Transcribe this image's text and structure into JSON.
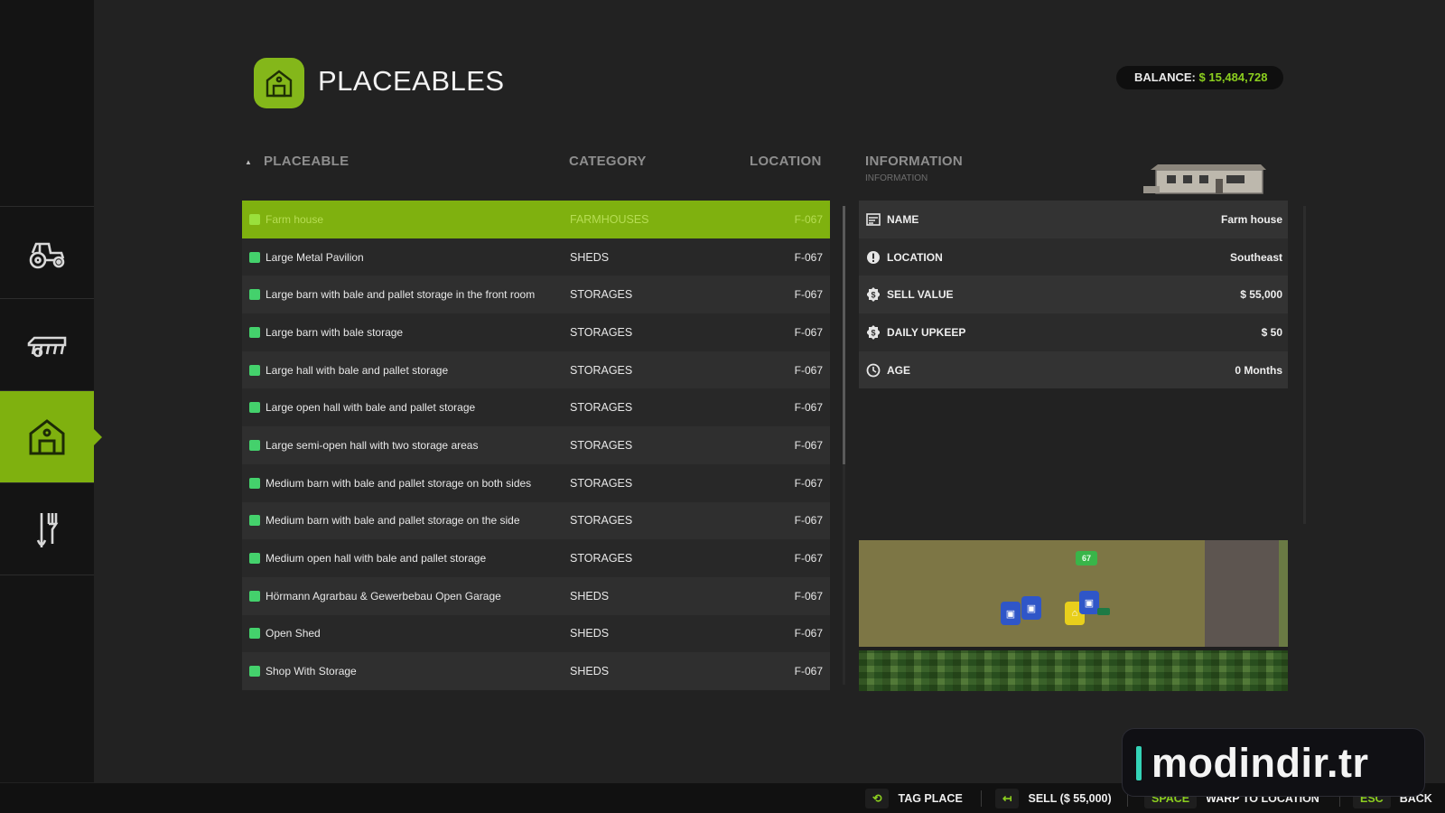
{
  "header": {
    "title": "PLACEABLES",
    "balance_label": "BALANCE:",
    "balance_value": "$ 15,484,728"
  },
  "sidebar": {
    "items": [
      {
        "icon": "tractor-icon"
      },
      {
        "icon": "cultivator-icon"
      },
      {
        "icon": "barn-icon",
        "active": true
      },
      {
        "icon": "tools-icon"
      }
    ]
  },
  "table": {
    "columns": {
      "placeable": "PLACEABLE",
      "category": "CATEGORY",
      "location": "LOCATION"
    },
    "rows": [
      {
        "name": "Farm house",
        "category": "FARMHOUSES",
        "location": "F-067",
        "selected": true
      },
      {
        "name": "Large Metal Pavilion",
        "category": "SHEDS",
        "location": "F-067"
      },
      {
        "name": "Large barn with bale and pallet storage in the front room",
        "category": "STORAGES",
        "location": "F-067"
      },
      {
        "name": "Large barn with bale storage",
        "category": "STORAGES",
        "location": "F-067"
      },
      {
        "name": "Large hall with bale and pallet storage",
        "category": "STORAGES",
        "location": "F-067"
      },
      {
        "name": "Large open hall with bale and pallet storage",
        "category": "STORAGES",
        "location": "F-067"
      },
      {
        "name": "Large semi-open hall with two storage areas",
        "category": "STORAGES",
        "location": "F-067"
      },
      {
        "name": "Medium barn with bale and pallet storage on both sides",
        "category": "STORAGES",
        "location": "F-067"
      },
      {
        "name": "Medium barn with bale and pallet storage on the side",
        "category": "STORAGES",
        "location": "F-067"
      },
      {
        "name": "Medium open hall with bale and pallet storage",
        "category": "STORAGES",
        "location": "F-067"
      },
      {
        "name": "Hörmann Agrarbau & Gewerbebau Open Garage",
        "category": "SHEDS",
        "location": "F-067"
      },
      {
        "name": "Open Shed",
        "category": "SHEDS",
        "location": "F-067"
      },
      {
        "name": "Shop With Storage",
        "category": "SHEDS",
        "location": "F-067"
      }
    ]
  },
  "info": {
    "title": "INFORMATION",
    "subtitle": "INFORMATION",
    "rows": [
      {
        "icon": "name-icon",
        "label": "NAME",
        "value": "Farm house"
      },
      {
        "icon": "location-icon",
        "label": "LOCATION",
        "value": "Southeast"
      },
      {
        "icon": "money-icon",
        "label": "SELL VALUE",
        "value": "$ 55,000"
      },
      {
        "icon": "money-icon",
        "label": "DAILY UPKEEP",
        "value": "$ 50"
      },
      {
        "icon": "clock-icon",
        "label": "AGE",
        "value": "0 Months"
      }
    ]
  },
  "map": {
    "field_badge": "67"
  },
  "bottombar": {
    "tag_label": "TAG PLACE",
    "sell_label": "SELL ($ 55,000)",
    "space_key": "SPACE",
    "warp_label": "WARP TO LOCATION",
    "esc_key": "ESC",
    "back_label": "BACK"
  },
  "watermark": "modindir.tr",
  "colors": {
    "accent": "#7fb10f",
    "balance": "#8ccf1f",
    "checkbox": "#44d16c"
  }
}
